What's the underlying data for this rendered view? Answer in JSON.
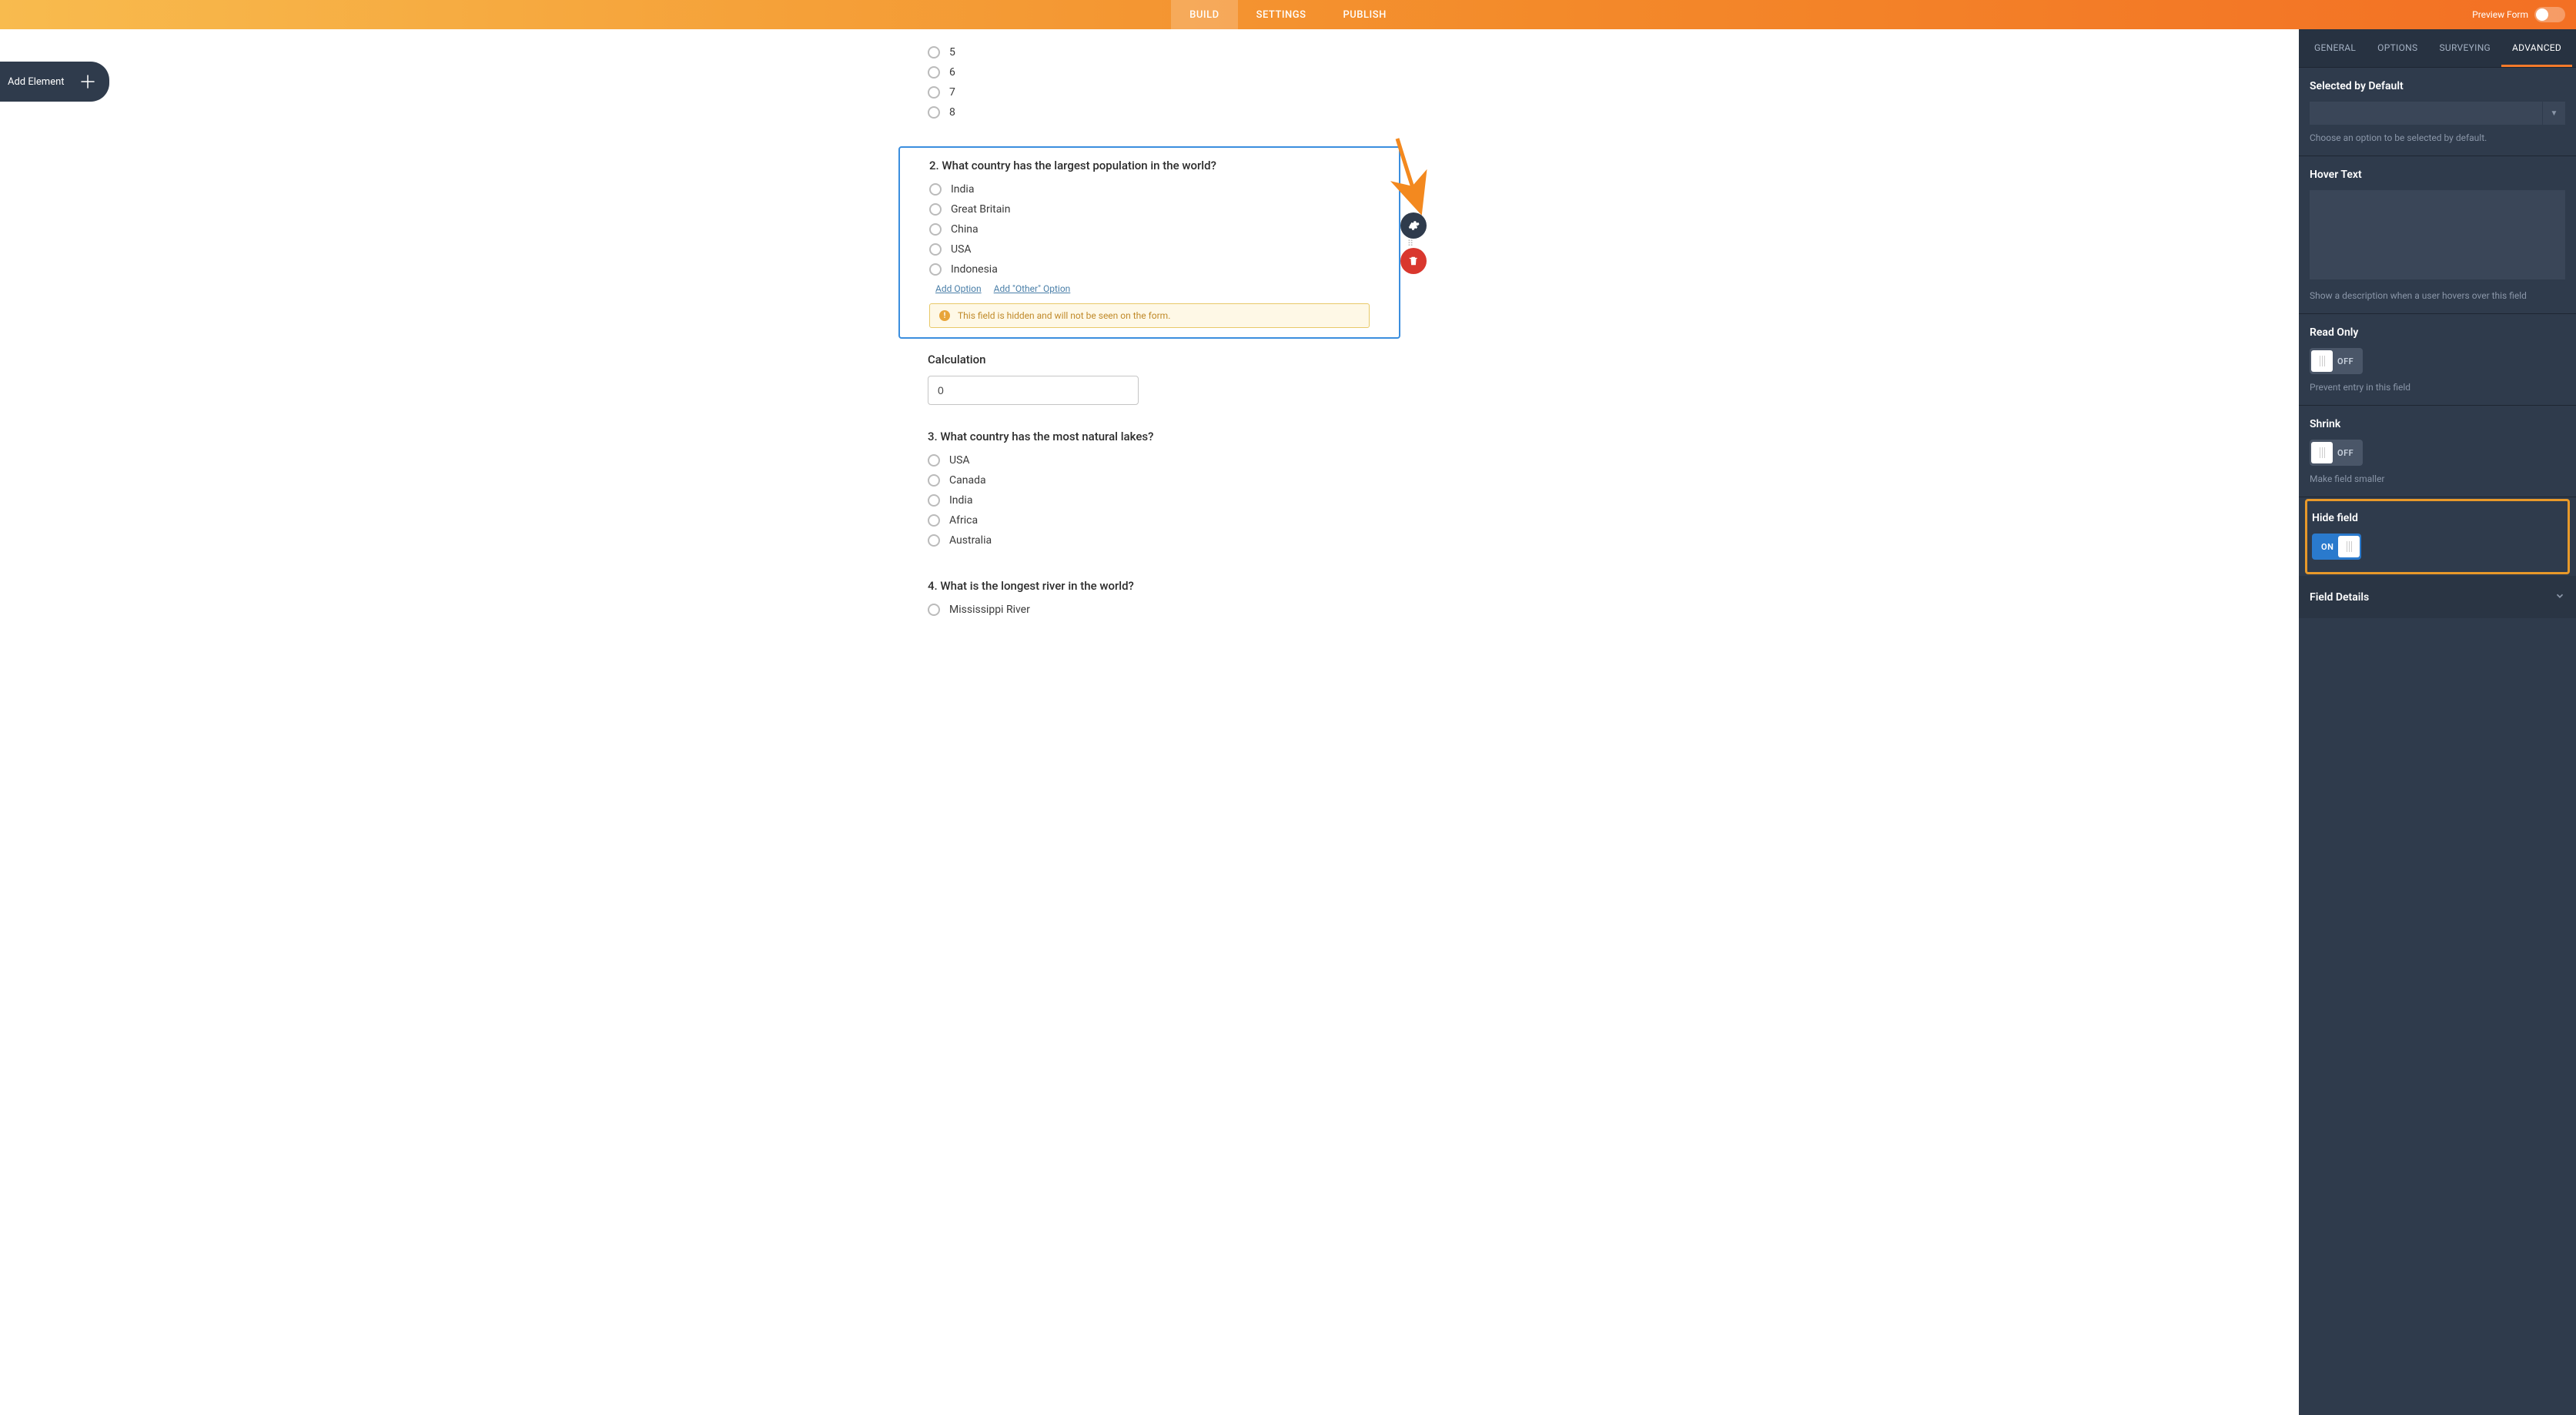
{
  "topnav": {
    "tabs": [
      "BUILD",
      "SETTINGS",
      "PUBLISH"
    ],
    "activeTab": 0,
    "previewLabel": "Preview Form"
  },
  "addElement": {
    "label": "Add Element"
  },
  "canvas": {
    "questions": [
      {
        "title": "",
        "partial": true,
        "options": [
          "5",
          "6",
          "7",
          "8"
        ]
      },
      {
        "title": "2. What country has the largest population in the world?",
        "selected": true,
        "options": [
          "India",
          "Great Britain",
          "China",
          "USA",
          "Indonesia"
        ],
        "addOptionLabel": "Add Option",
        "addOtherLabel": "Add \"Other\" Option",
        "hiddenWarning": "This field is hidden and will not be seen on the form."
      },
      {
        "title": "Calculation",
        "isCalc": true,
        "value": "0"
      },
      {
        "title": "3. What country has the most natural lakes?",
        "options": [
          "USA",
          "Canada",
          "India",
          "Africa",
          "Australia"
        ]
      },
      {
        "title": "4. What is the longest river in the world?",
        "options": [
          "Mississippi River"
        ],
        "cutoff": true
      }
    ]
  },
  "panel": {
    "tabs": [
      "GENERAL",
      "OPTIONS",
      "SURVEYING",
      "ADVANCED"
    ],
    "activeTab": 3,
    "sections": {
      "selectedDefault": {
        "title": "Selected by Default",
        "help": "Choose an option to be selected by default."
      },
      "hoverText": {
        "title": "Hover Text",
        "help": "Show a description when a user hovers over this field"
      },
      "readOnly": {
        "title": "Read Only",
        "state": "OFF",
        "help": "Prevent entry in this field"
      },
      "shrink": {
        "title": "Shrink",
        "state": "OFF",
        "help": "Make field smaller"
      },
      "hideField": {
        "title": "Hide field",
        "state": "ON"
      },
      "fieldDetails": {
        "title": "Field Details"
      }
    }
  }
}
